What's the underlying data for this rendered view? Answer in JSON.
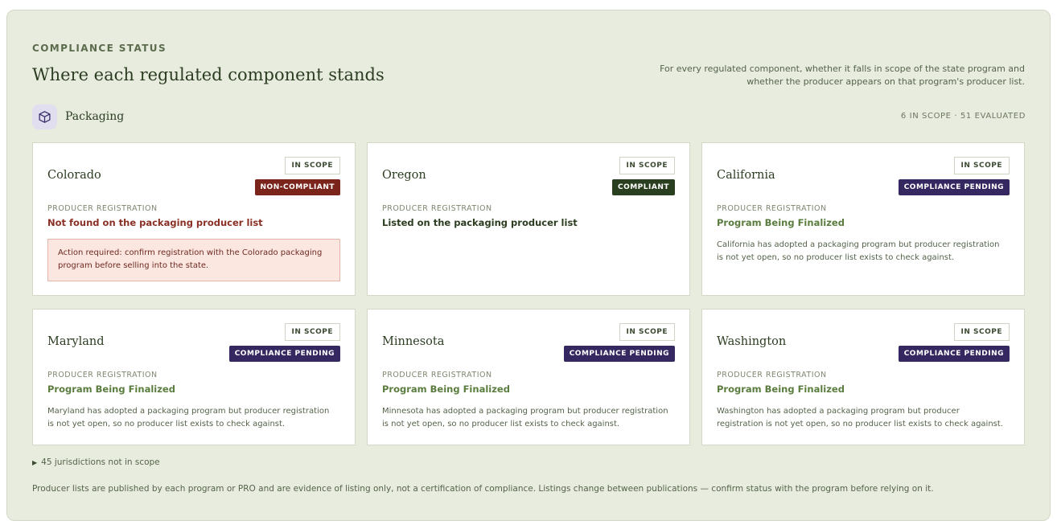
{
  "header": {
    "eyebrow": "COMPLIANCE STATUS",
    "title": "Where each regulated component stands",
    "description": "For every regulated component, whether it falls in scope of the state program and whether the producer appears on that program's producer list."
  },
  "group": {
    "icon": "package-icon",
    "label": "Packaging",
    "count": "6 IN SCOPE · 51 EVALUATED"
  },
  "cards": [
    {
      "state": "Colorado",
      "scope": "IN SCOPE",
      "status": "NON-COMPLIANT",
      "field_label": "PRODUCER REGISTRATION",
      "field_value": "Not found on the packaging producer list",
      "alert": "Action required: confirm registration with the Colorado packaging program before selling into the state."
    },
    {
      "state": "Oregon",
      "scope": "IN SCOPE",
      "status": "COMPLIANT",
      "field_label": "PRODUCER REGISTRATION",
      "field_value": "Listed on the packaging producer list"
    },
    {
      "state": "California",
      "scope": "IN SCOPE",
      "status": "COMPLIANCE PENDING",
      "field_label": "PRODUCER REGISTRATION",
      "field_value": "Program Being Finalized",
      "note": "California has adopted a packaging program but producer registration is not yet open, so no producer list exists to check against."
    },
    {
      "state": "Maryland",
      "scope": "IN SCOPE",
      "status": "COMPLIANCE PENDING",
      "field_label": "PRODUCER REGISTRATION",
      "field_value": "Program Being Finalized",
      "note": "Maryland has adopted a packaging program but producer registration is not yet open, so no producer list exists to check against."
    },
    {
      "state": "Minnesota",
      "scope": "IN SCOPE",
      "status": "COMPLIANCE PENDING",
      "field_label": "PRODUCER REGISTRATION",
      "field_value": "Program Being Finalized",
      "note": "Minnesota has adopted a packaging program but producer registration is not yet open, so no producer list exists to check against."
    },
    {
      "state": "Washington",
      "scope": "IN SCOPE",
      "status": "COMPLIANCE PENDING",
      "field_label": "PRODUCER REGISTRATION",
      "field_value": "Program Being Finalized",
      "note": "Washington has adopted a packaging program but producer registration is not yet open, so no producer list exists to check against."
    }
  ],
  "colors": {
    "non_compliant": "#7a241c",
    "compliant": "#2a3f20",
    "pending": "#352861",
    "panel_bg": "#e8ecdf"
  },
  "disclosure": {
    "icon": "triangle-right-icon",
    "label": "45 jurisdictions not in scope"
  },
  "footer": "Producer lists are published by each program or PRO and are evidence of listing only, not a certification of compliance. Listings change between publications — confirm status with the program before relying on it."
}
